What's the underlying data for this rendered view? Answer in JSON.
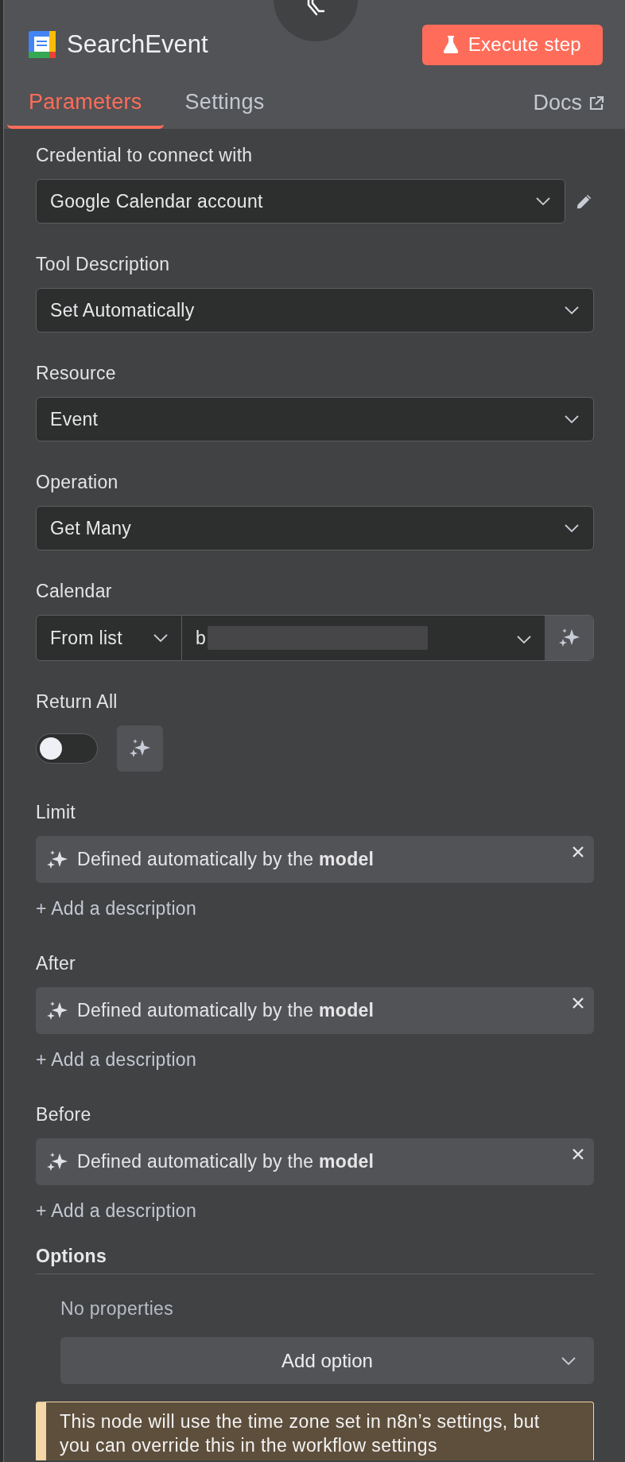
{
  "node": {
    "title": "SearchEvent",
    "execute_button": "Execute step"
  },
  "tabs": [
    {
      "label": "Parameters",
      "selected": true
    },
    {
      "label": "Settings",
      "selected": false
    }
  ],
  "docs_link": "Docs",
  "parameters": [
    {
      "kind": "select",
      "label": "Credential to connect with",
      "value": "Google Calendar account",
      "editable": true
    },
    {
      "kind": "select",
      "label": "Tool Description",
      "value": "Set Automatically",
      "editable": false
    },
    {
      "kind": "select",
      "label": "Resource",
      "value": "Event",
      "editable": false
    },
    {
      "kind": "select",
      "label": "Operation",
      "value": "Get Many",
      "editable": false
    },
    {
      "kind": "locator",
      "label": "Calendar",
      "mode": "From list",
      "value": "b"
    },
    {
      "kind": "toggle",
      "label": "Return All",
      "on": false
    },
    {
      "kind": "auto",
      "label": "Limit",
      "text": "Defined automatically by the **model**",
      "add_description": "+ Add a description"
    },
    {
      "kind": "auto",
      "label": "After",
      "text": "Defined automatically by the **model**",
      "add_description": "+ Add a description"
    },
    {
      "kind": "auto",
      "label": "Before",
      "text": "Defined automatically by the **model**",
      "add_description": "+ Add a description"
    }
  ],
  "options": {
    "label": "Options",
    "empty_text": "No properties",
    "add_button": "Add option"
  },
  "notice": "This node will use the time zone set in n8n’s settings, but you can override this in the workflow settings"
}
